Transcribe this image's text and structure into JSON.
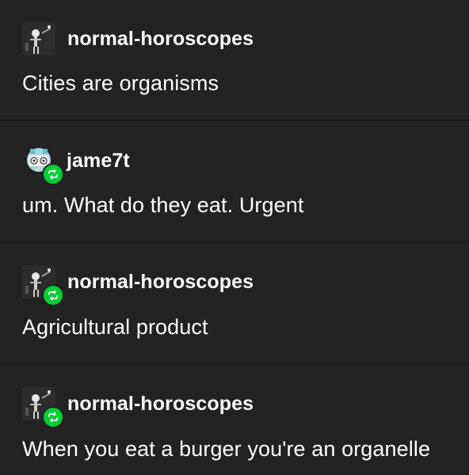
{
  "thread": {
    "posts": [
      {
        "username": "normal-horoscopes",
        "avatar": "skeleton-avatar",
        "reblog": false,
        "text": "Cities are organisms"
      },
      {
        "username": "jame7t",
        "avatar": "pixel-character-avatar",
        "reblog": true,
        "text": "um. What do they eat. Urgent"
      },
      {
        "username": "normal-horoscopes",
        "avatar": "skeleton-avatar",
        "reblog": true,
        "text": "Agricultural product"
      },
      {
        "username": "normal-horoscopes",
        "avatar": "skeleton-avatar",
        "reblog": true,
        "text": "When you eat a burger you're an organelle"
      }
    ]
  },
  "colors": {
    "background": "#222222",
    "divider": "#1a1a1a",
    "text": "#ffffff",
    "reblog_badge": "#00cf35"
  }
}
